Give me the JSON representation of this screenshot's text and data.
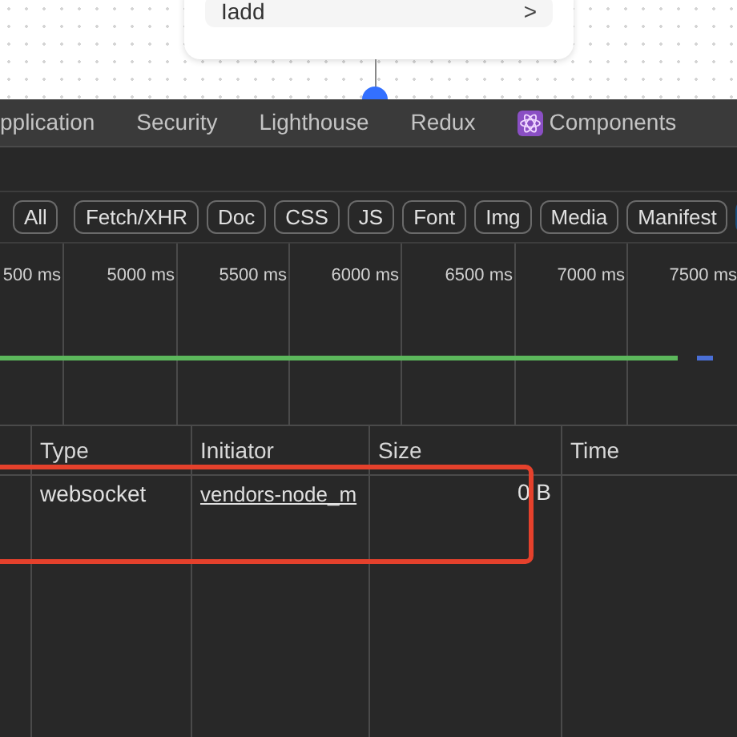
{
  "canvas_node": {
    "label": "Iadd",
    "chevron": ">"
  },
  "tabs": [
    {
      "label": "pplication",
      "selected": false
    },
    {
      "label": "Security",
      "selected": false
    },
    {
      "label": "Lighthouse",
      "selected": false
    },
    {
      "label": "Redux",
      "selected": false
    },
    {
      "label": "Components",
      "selected": false,
      "kind": "react"
    }
  ],
  "filters": [
    {
      "label": "All",
      "selected": false
    },
    {
      "label": "Fetch/XHR",
      "selected": false
    },
    {
      "label": "Doc",
      "selected": false
    },
    {
      "label": "CSS",
      "selected": false
    },
    {
      "label": "JS",
      "selected": false
    },
    {
      "label": "Font",
      "selected": false
    },
    {
      "label": "Img",
      "selected": false
    },
    {
      "label": "Media",
      "selected": false
    },
    {
      "label": "Manifest",
      "selected": false
    }
  ],
  "timeline": {
    "ticks": [
      "500 ms",
      "5000 ms",
      "5500 ms",
      "6000 ms",
      "6500 ms",
      "7000 ms",
      "7500 ms"
    ],
    "level": 0.95
  },
  "table": {
    "columns": [
      "Type",
      "Initiator",
      "Size",
      "Time"
    ],
    "rows": [
      {
        "type": "websocket",
        "initiator": "vendors-node_m",
        "size": "0 B"
      }
    ]
  }
}
